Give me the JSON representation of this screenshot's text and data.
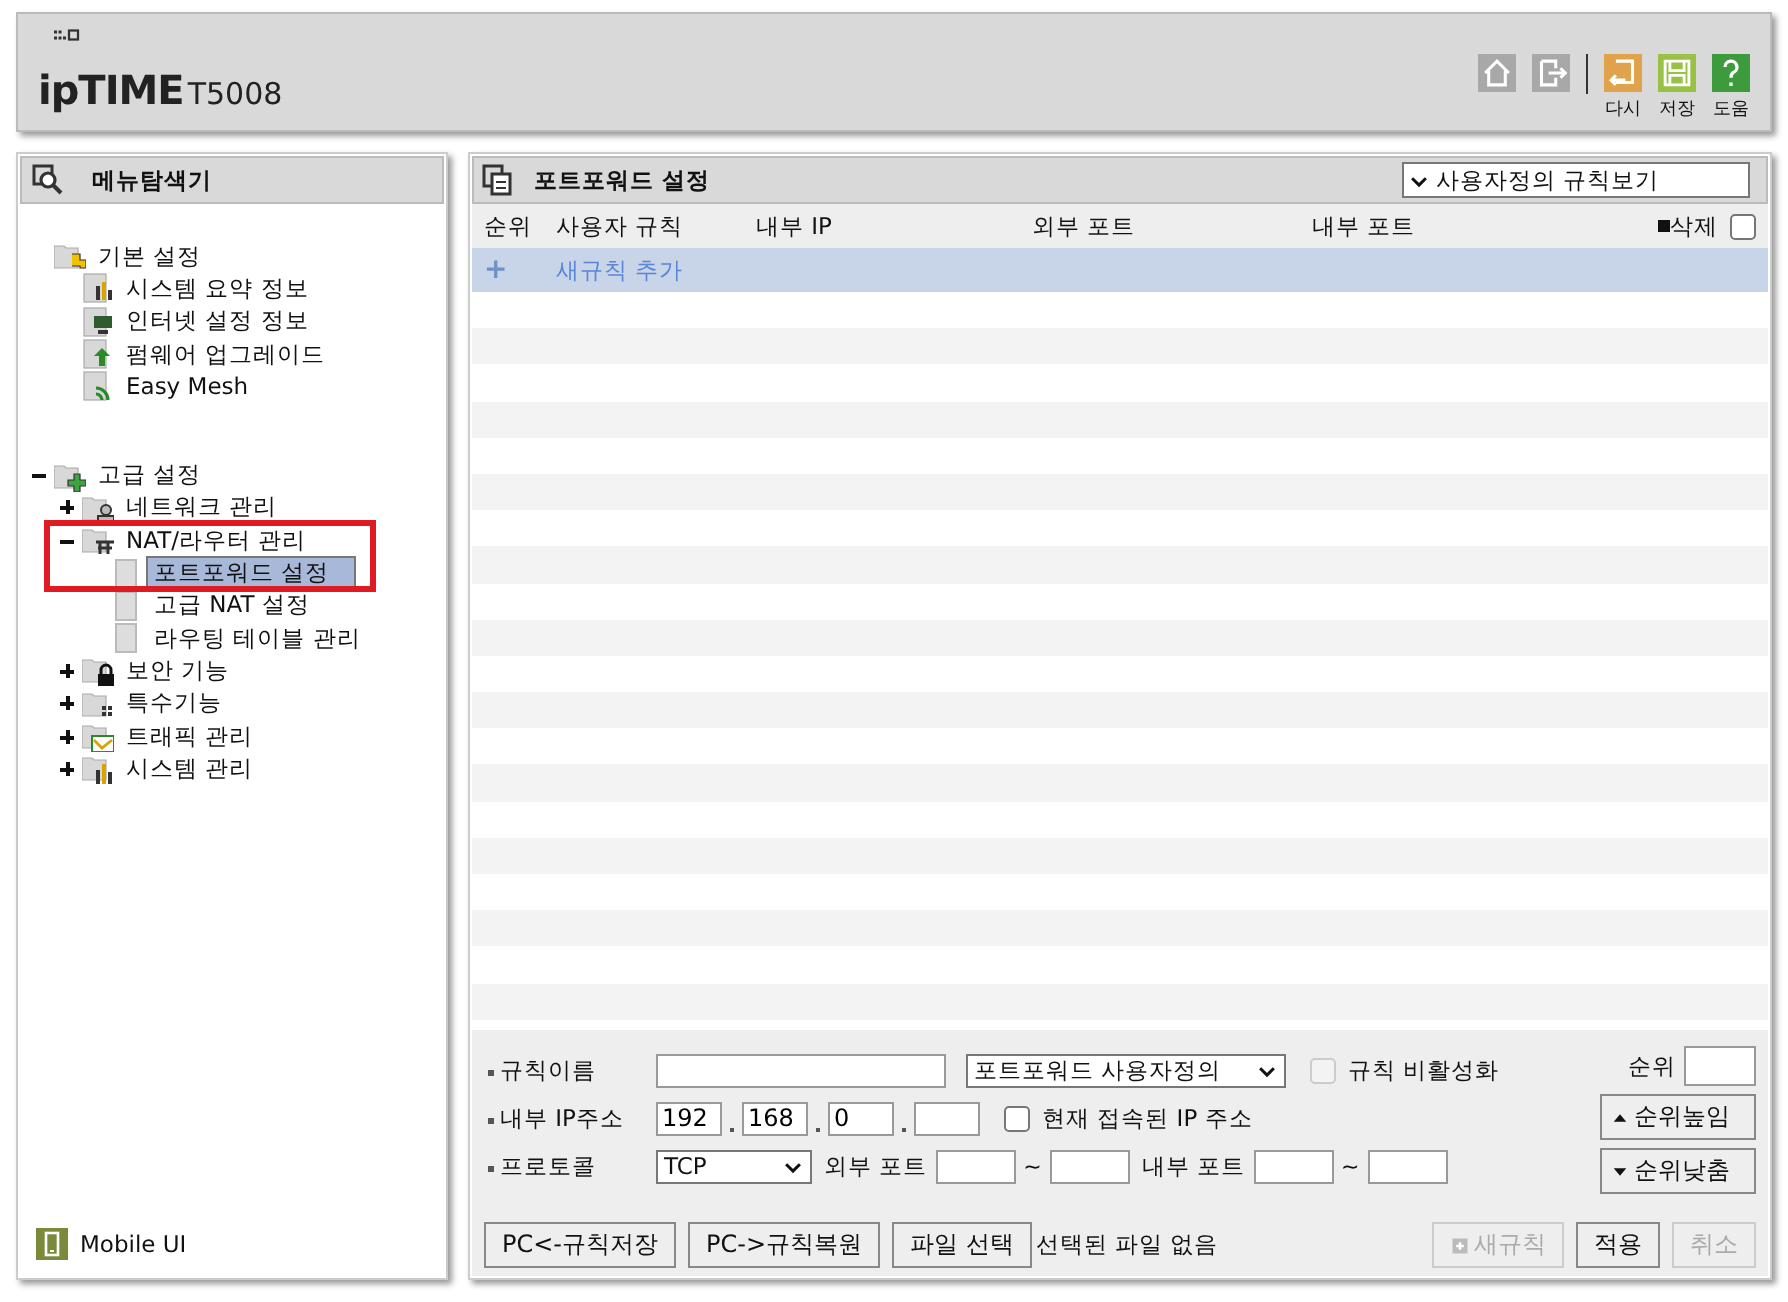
{
  "header": {
    "brand": "ipTIME",
    "model": "T5008",
    "actions": [
      {
        "kind": "home"
      },
      {
        "kind": "logout"
      },
      {
        "kind": "refresh",
        "label": "다시"
      },
      {
        "kind": "save",
        "label": "저장"
      },
      {
        "kind": "help",
        "label": "도움"
      }
    ]
  },
  "sidebar": {
    "title": "메뉴탐색기",
    "tree": [
      {
        "label": "기본 설정",
        "kind": "folder",
        "children": [
          {
            "label": "시스템 요약 정보",
            "kind": "page",
            "selected": false
          },
          {
            "label": "인터넷 설정 정보",
            "kind": "page",
            "selected": false
          },
          {
            "label": "펌웨어 업그레이드",
            "kind": "page",
            "selected": false
          },
          {
            "label": "Easy Mesh",
            "kind": "page",
            "selected": false
          }
        ]
      },
      {
        "label": "고급 설정",
        "kind": "folder",
        "expanded": true,
        "children": [
          {
            "label": "네트워크 관리",
            "kind": "folder",
            "expanded": false
          },
          {
            "label": "NAT/라우터 관리",
            "kind": "folder",
            "expanded": true,
            "highlighted": true,
            "children": [
              {
                "label": "포트포워드 설정",
                "kind": "blank",
                "selected": true
              },
              {
                "label": "고급 NAT 설정",
                "kind": "blank",
                "selected": false
              },
              {
                "label": "라우팅 테이블 관리",
                "kind": "blank",
                "selected": false
              }
            ]
          },
          {
            "label": "보안 기능",
            "kind": "folder",
            "expanded": false
          },
          {
            "label": "특수기능",
            "kind": "folder",
            "expanded": false
          },
          {
            "label": "트래픽 관리",
            "kind": "folder",
            "expanded": false
          },
          {
            "label": "시스템 관리",
            "kind": "folder",
            "expanded": false
          }
        ]
      }
    ],
    "footer": "Mobile UI"
  },
  "panel": {
    "title": "포트포워드 설정",
    "view_select": "사용자정의 규칙보기",
    "table": {
      "columns": [
        "순위",
        "사용자 규칙",
        "내부 IP",
        "외부 포트",
        "내부 포트",
        "삭제"
      ],
      "select_all": false,
      "add_row": {
        "icon": "+",
        "label": "새규칙 추가"
      }
    },
    "form": {
      "rule_name": {
        "label": "규칙이름"
      },
      "rule_type": "포트포워드 사용자정의",
      "disable_rule": {
        "label": "규칙 비활성화",
        "checked": false,
        "disabled": true
      },
      "internal_ip": {
        "label": "내부 IP주소",
        "octets": [
          "192",
          "168",
          "0"
        ]
      },
      "current_ip": {
        "label": "현재 접속된 IP 주소",
        "checked": false,
        "disabled": false
      },
      "protocol": {
        "label": "프로토콜",
        "value": "TCP"
      },
      "external_port": {
        "label": "외부 포트",
        "sep": "~"
      },
      "internal_port": {
        "label": "내부 포트",
        "sep": "~"
      },
      "rank": {
        "label": "순위"
      },
      "rank_up": "순위높임",
      "rank_down": "순위낮춤"
    },
    "file_buttons": [
      {
        "label": "PC<-규칙저장",
        "disabled": false
      },
      {
        "label": "PC->규칙복원",
        "disabled": false
      },
      {
        "label": "파일 선택",
        "disabled": false
      }
    ],
    "buttons": [
      {
        "label": "새규칙",
        "disabled": true,
        "kind": "add"
      },
      {
        "label": "적용",
        "disabled": false
      },
      {
        "label": "취소",
        "disabled": true
      }
    ],
    "file_status": "선택된 파일 없음"
  }
}
